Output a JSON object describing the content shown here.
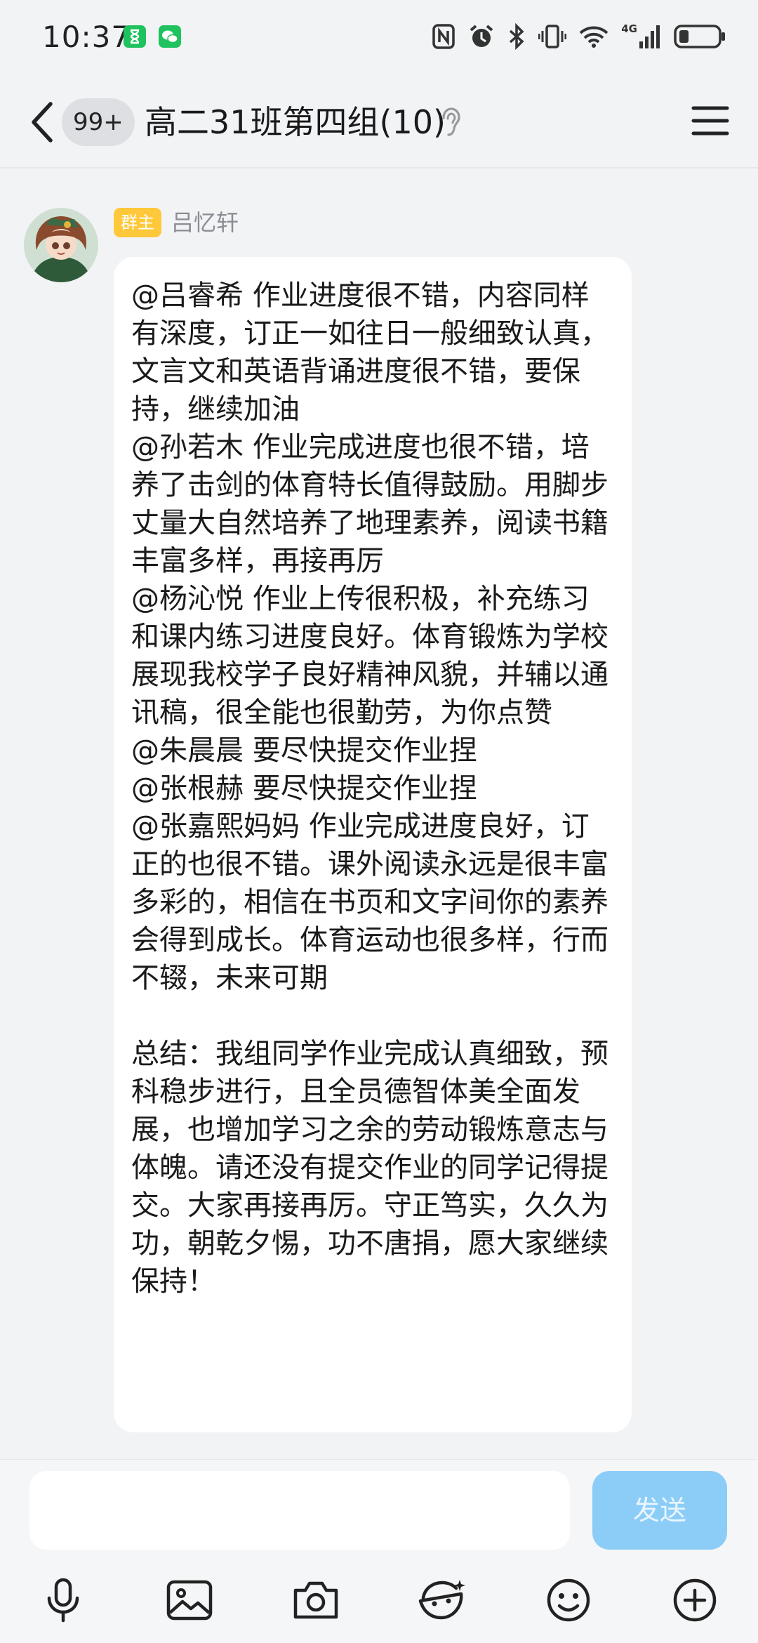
{
  "status_bar": {
    "time": "10:37",
    "left_icons": [
      "hourglass-app-icon",
      "wechat-app-icon"
    ],
    "right_icons": [
      "nfc-icon",
      "alarm-icon",
      "bluetooth-icon",
      "vibrate-icon",
      "wifi-icon",
      "signal-4g-icon",
      "battery-icon"
    ],
    "network_label": "4G"
  },
  "header": {
    "unread_count": "99+",
    "title": "高二31班第四组(10)",
    "back_icon": "chevron-left-icon",
    "ear_icon": "ear-mode-icon",
    "menu_icon": "hamburger-menu-icon"
  },
  "message": {
    "badge": "群主",
    "sender": "吕忆轩",
    "avatar_icon": "user-avatar",
    "text": "@吕睿希 作业进度很不错，内容同样有深度，订正一如往日一般细致认真，文言文和英语背诵进度很不错，要保持，继续加油\n@孙若木 作业完成进度也很不错，培养了击剑的体育特长值得鼓励。用脚步丈量大自然培养了地理素养，阅读书籍丰富多样，再接再厉\n@杨沁悦 作业上传很积极，补充练习和课内练习进度良好。体育锻炼为学校展现我校学子良好精神风貌，并辅以通讯稿，很全能也很勤劳，为你点赞\n@朱晨晨 要尽快提交作业捏\n@张根赫 要尽快提交作业捏\n@张嘉熙妈妈 作业完成进度良好，订正的也很不错。课外阅读永远是很丰富多彩的，相信在书页和文字间你的素养会得到成长。体育运动也很多样，行而不辍，未来可期\n\n总结：我组同学作业完成认真细致，预科稳步进行，且全员德智体美全面发展，也增加学习之余的劳动锻炼意志与体魄。请还没有提交作业的同学记得提交。大家再接再厉。守正笃实，久久为功，朝乾夕惕，功不唐捐，愿大家继续保持！"
  },
  "composer": {
    "input_value": "",
    "send_label": "发送",
    "tools": [
      "microphone-icon",
      "image-icon",
      "camera-icon",
      "magic-emoji-icon",
      "smiley-icon",
      "plus-icon"
    ]
  },
  "colors": {
    "background": "#f2f3f5",
    "bubble": "#ffffff",
    "owner_badge": "#ffc83a",
    "send_button_disabled": "#8ccdf8",
    "status_app_green": "#1fc25e"
  }
}
